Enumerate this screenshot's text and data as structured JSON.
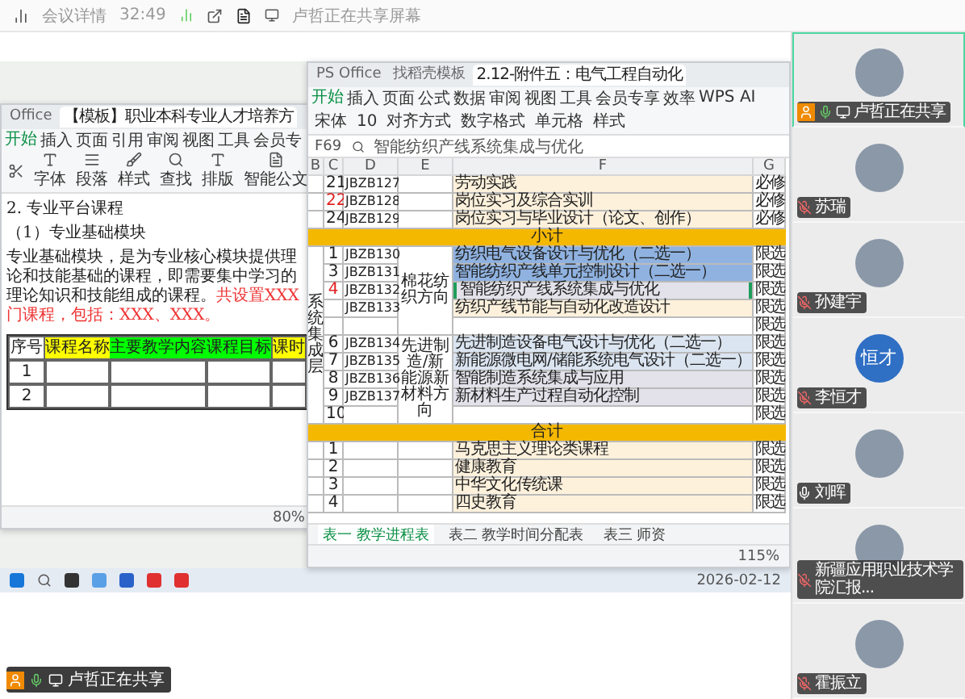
{
  "top_bar": {
    "meeting_details": "会议详情",
    "duration": "32:49",
    "sharing_notice": "卢哲正在共享屏幕"
  },
  "doc_window": {
    "tabs": [
      {
        "label": "Office",
        "selected": false
      },
      {
        "label": "【模板】职业本科专业人才培养方",
        "selected": true
      }
    ],
    "menu": [
      {
        "label": "开始",
        "selected": true
      },
      {
        "label": "插入",
        "selected": false
      },
      {
        "label": "页面",
        "selected": false
      },
      {
        "label": "引用",
        "selected": false
      },
      {
        "label": "审阅",
        "selected": false
      },
      {
        "label": "视图",
        "selected": false
      },
      {
        "label": "工具",
        "selected": false
      },
      {
        "label": "会员专",
        "selected": false
      }
    ],
    "ribbon": [
      "字体",
      "段落",
      "样式",
      "查找",
      "排版",
      "智能公文"
    ],
    "heading": "2. 专业平台课程",
    "subheading": "（1）专业基础模块",
    "paragraph": "专业基础模块，是为专业核心模块提供理论和技能基础的课程，即需要集中学习的理论知识和技能组成的课程。",
    "note": "共设置XXX门课程，包括：XXX、XXX。",
    "table": {
      "columns": [
        {
          "label": "序号"
        },
        {
          "label": "课程名称",
          "color": "#ffff00"
        },
        {
          "label": "主要教学内容",
          "color": "#00ff00"
        },
        {
          "label": "课程目标",
          "color": "#00ff00"
        },
        {
          "label": "课时",
          "color": "#ffff00"
        }
      ],
      "rows": [
        {
          "number": "1"
        },
        {
          "number": "2"
        }
      ]
    },
    "zoom": "80%"
  },
  "sheet_window": {
    "tabs": [
      {
        "label": "PS Office",
        "selected": false
      },
      {
        "label": "找稻壳模板",
        "selected": false
      },
      {
        "label": "2.12-附件五：电气工程自动化",
        "selected": true
      }
    ],
    "menu": [
      {
        "label": "开始",
        "selected": true
      },
      {
        "label": "插入",
        "selected": false
      },
      {
        "label": "页面",
        "selected": false
      },
      {
        "label": "公式",
        "selected": false
      },
      {
        "label": "数据",
        "selected": false
      },
      {
        "label": "审阅",
        "selected": false
      },
      {
        "label": "视图",
        "selected": false
      },
      {
        "label": "工具",
        "selected": false
      },
      {
        "label": "会员专享",
        "selected": false
      },
      {
        "label": "效率",
        "selected": false
      },
      {
        "label": "WPS AI",
        "selected": false
      }
    ],
    "font": "宋体",
    "font_size": "10",
    "ribbon": [
      "对齐方式",
      "数字格式",
      "单元格",
      "样式"
    ],
    "name_box": "F69",
    "formula": "智能纺织产线系统集成与优化",
    "columns": [
      "B",
      "C",
      "D",
      "E",
      "F",
      "G"
    ],
    "sections": [
      {
        "kind": "rows",
        "groups": [
          {
            "rows": [
              {
                "num": "21",
                "code": "JBZB127",
                "course": "劳动实践",
                "type": "必修",
                "color": "#fdf1dc",
                "flagged": false,
                "selected": false
              },
              {
                "num": "22",
                "code": "JBZB128",
                "course": "岗位实习及综合实训",
                "type": "必修",
                "color": "#fdf1dc",
                "flagged": true,
                "selected": false
              },
              {
                "num": "24",
                "code": "JBZB129",
                "course": "岗位实习与毕业设计（论文、创作）",
                "type": "必修",
                "color": "#fdf1dc",
                "flagged": false,
                "selected": false
              }
            ]
          }
        ]
      },
      {
        "kind": "band",
        "label": "小计"
      },
      {
        "kind": "rows",
        "layer": "系统集成层",
        "groups": [
          {
            "direction": "棉花纺织方向",
            "rows": [
              {
                "num": "1",
                "code": "JBZB130",
                "course": "纺织电气设备设计与优化（二选一）",
                "type": "限选",
                "color": "#8fb2e0",
                "flagged": false,
                "selected": false
              },
              {
                "num": "3",
                "code": "JBZB131",
                "course": "智能纺织产线单元控制设计（二选一）",
                "type": "限选",
                "color": "#8fb2e0",
                "flagged": false,
                "selected": false
              },
              {
                "num": "4",
                "code": "JBZB132",
                "course": "智能纺织产线系统集成与优化",
                "type": "限选",
                "color": "#e3e2ea",
                "flagged": true,
                "selected": true
              },
              {
                "code": "JBZB133",
                "course": "纺织产线节能与自动化改造设计",
                "type": "限选",
                "color": "#fdf1dc",
                "selected": false
              },
              {
                "type": "限选",
                "color": "#ffffff",
                "selected": false
              }
            ]
          },
          {
            "direction": "先进制造/新能源新材料方向",
            "rows": [
              {
                "num": "6",
                "code": "JBZB134",
                "course": "先进制造设备电气设计与优化（二选一）",
                "type": "限选",
                "color": "#dbe5f1",
                "flagged": false,
                "selected": false
              },
              {
                "num": "7",
                "code": "JBZB135",
                "course": "新能源微电网/储能系统电气设计（二选一）",
                "type": "限选",
                "color": "#dbe5f1",
                "flagged": false,
                "selected": false
              },
              {
                "num": "8",
                "code": "JBZB136",
                "course": "智能制造系统集成与应用",
                "type": "限选",
                "color": "#e3e2ea",
                "flagged": false,
                "selected": false
              },
              {
                "num": "9",
                "code": "JBZB137",
                "course": "新材料生产过程自动化控制",
                "type": "限选",
                "color": "#e3e2ea",
                "flagged": false,
                "selected": false
              },
              {
                "num": "10",
                "type": "限选",
                "color": "#ffffff",
                "flagged": false,
                "selected": false
              }
            ]
          }
        ]
      },
      {
        "kind": "band",
        "label": "合计"
      },
      {
        "kind": "rows",
        "groups": [
          {
            "rows": [
              {
                "num": "1",
                "course": "马克思主义理论类课程",
                "type": "限选",
                "color": "#fdf1dc",
                "flagged": false,
                "selected": false
              },
              {
                "num": "2",
                "course": "健康教育",
                "type": "限选",
                "color": "#fdf1dc",
                "flagged": false,
                "selected": false
              },
              {
                "num": "3",
                "course": "中华文化传统课",
                "type": "限选",
                "color": "#fdf1dc",
                "flagged": false,
                "selected": false
              },
              {
                "num": "4",
                "course": "四史教育",
                "type": "限选",
                "color": "#fdf1dc",
                "flagged": false,
                "selected": false
              }
            ]
          }
        ]
      }
    ],
    "sheet_tabs": [
      {
        "label": "表一 教学进程表",
        "selected": true
      },
      {
        "label": "表二 教学时间分配表",
        "selected": false
      },
      {
        "label": "表三 师资",
        "selected": false
      }
    ],
    "zoom": "115%"
  },
  "taskbar": {
    "date": "2026-02-12"
  },
  "participants": [
    {
      "name": "卢哲正在共享",
      "muted": false,
      "sharing": true,
      "kind": "photo"
    },
    {
      "name": "苏瑞",
      "muted": true,
      "sharing": false,
      "kind": "photo"
    },
    {
      "name": "孙建宇",
      "muted": true,
      "sharing": false,
      "kind": "photo"
    },
    {
      "name": "李恒才",
      "muted": true,
      "sharing": false,
      "kind": "initials",
      "avatar_text": "恒才"
    },
    {
      "name": "刘晖",
      "muted": false,
      "sharing": false,
      "kind": "photo"
    },
    {
      "name": "新疆应用职业技术学院汇报...",
      "muted": true,
      "sharing": false,
      "kind": "photo"
    },
    {
      "name": "霍振立",
      "muted": true,
      "sharing": false,
      "kind": "photo"
    }
  ],
  "share_badge": {
    "label": "卢哲正在共享"
  }
}
